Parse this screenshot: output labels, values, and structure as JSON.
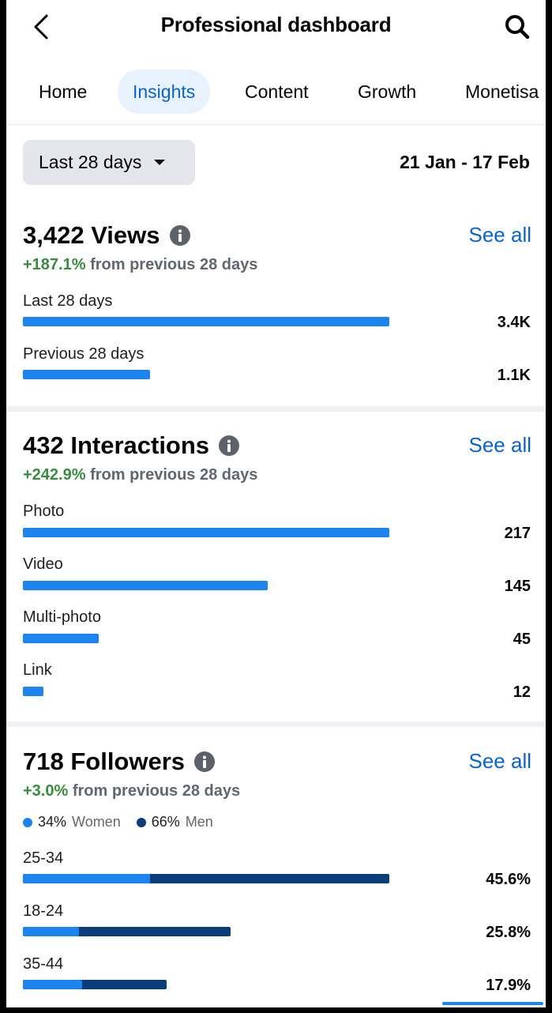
{
  "header": {
    "title": "Professional dashboard",
    "back_icon": "chevron-left-icon",
    "search_icon": "search-icon"
  },
  "tabs": [
    {
      "label": "Home",
      "active": false
    },
    {
      "label": "Insights",
      "active": true
    },
    {
      "label": "Content",
      "active": false
    },
    {
      "label": "Growth",
      "active": false
    },
    {
      "label": "Monetisa",
      "active": false
    }
  ],
  "filter": {
    "range_label": "Last 28 days",
    "date_range": "21 Jan - 17 Feb"
  },
  "views": {
    "title": "3,422 Views",
    "see_all": "See all",
    "delta_pct": "+187.1%",
    "delta_text": " from previous 28 days",
    "rows": [
      {
        "label": "Last 28 days",
        "value": "3.4K",
        "fraction": 1.0
      },
      {
        "label": "Previous 28 days",
        "value": "1.1K",
        "fraction": 0.348
      }
    ]
  },
  "interactions": {
    "title": "432 Interactions",
    "see_all": "See all",
    "delta_pct": "+242.9%",
    "delta_text": " from previous 28 days",
    "rows": [
      {
        "label": "Photo",
        "value": "217",
        "fraction": 1.0
      },
      {
        "label": "Video",
        "value": "145",
        "fraction": 0.668
      },
      {
        "label": "Multi-photo",
        "value": "45",
        "fraction": 0.207
      },
      {
        "label": "Link",
        "value": "12",
        "fraction": 0.055
      }
    ]
  },
  "followers": {
    "title": "718 Followers",
    "see_all": "See all",
    "delta_pct": "+3.0%",
    "delta_text": " from previous 28 days",
    "legend": [
      {
        "pct": "34%",
        "label": "Women",
        "color": "#1b84ee"
      },
      {
        "pct": "66%",
        "label": "Men",
        "color": "#0b3d7a"
      }
    ],
    "rows": [
      {
        "label": "25-34",
        "value": "45.6%",
        "fraction": 1.0,
        "women_fraction": 0.346
      },
      {
        "label": "18-24",
        "value": "25.8%",
        "fraction": 0.566,
        "women_fraction": 0.27
      },
      {
        "label": "35-44",
        "value": "17.9%",
        "fraction": 0.392,
        "women_fraction": 0.41
      }
    ]
  },
  "colors": {
    "accent": "#0b63c9",
    "bar": "#1b84ee",
    "bar_dark": "#0b3d7a",
    "positive": "#3a8a3f"
  }
}
